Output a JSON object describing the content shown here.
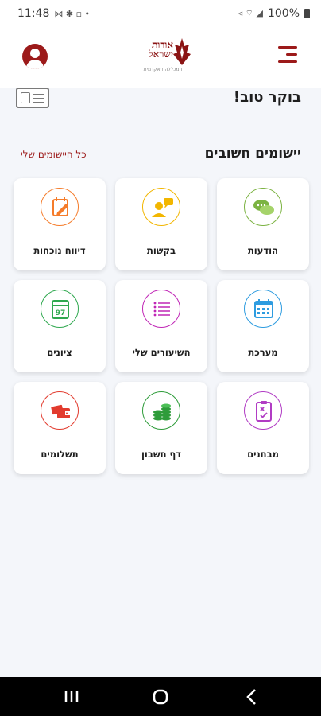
{
  "status_bar": {
    "time": "11:48",
    "battery": "100%"
  },
  "header": {
    "logo_line1": "אורות",
    "logo_line2": "ישראל",
    "logo_sub": "המכללה האקדמית"
  },
  "greeting": "בוקר טוב!",
  "section": {
    "title": "יישומים חשובים",
    "all_apps_link": "כל היישומים שלי"
  },
  "tiles": [
    {
      "label": "הודעות",
      "icon": "chat-icon",
      "color": "#7cb342"
    },
    {
      "label": "בקשות",
      "icon": "request-icon",
      "color": "#f2b600"
    },
    {
      "label": "דיווח נוכחות",
      "icon": "edit-calendar-icon",
      "color": "#f57c2b"
    },
    {
      "label": "מערכת",
      "icon": "calendar-icon",
      "color": "#2e9ce0"
    },
    {
      "label": "השיעורים שלי",
      "icon": "list-icon",
      "color": "#c026b6"
    },
    {
      "label": "ציונים",
      "icon": "grades-icon",
      "color": "#2fa84f"
    },
    {
      "label": "מבחנים",
      "icon": "exam-icon",
      "color": "#b13cc4"
    },
    {
      "label": "דף חשבון",
      "icon": "coins-icon",
      "color": "#2e9c3a"
    },
    {
      "label": "תשלומים",
      "icon": "wallet-icon",
      "color": "#e23b2e"
    }
  ],
  "colors": {
    "brand": "#9c1a1a",
    "background": "#f4f6fa"
  }
}
